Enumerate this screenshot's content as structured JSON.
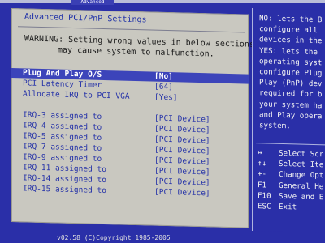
{
  "tab": {
    "label": "Advanced"
  },
  "main": {
    "title": "Advanced PCI/PnP Settings",
    "warning_line1": "WARNING: Setting wrong values in below sections",
    "warning_line2": "may cause system to malfunction.",
    "rows": [
      {
        "label": "Plug And Play O/S",
        "value": "[No]"
      },
      {
        "label": "PCI Latency Timer",
        "value": "[64]"
      },
      {
        "label": "Allocate IRQ to PCI VGA",
        "value": "[Yes]"
      },
      {
        "label": "IRQ-3 assigned to",
        "value": "[PCI Device]"
      },
      {
        "label": "IRQ-4 assigned to",
        "value": "[PCI Device]"
      },
      {
        "label": "IRQ-5 assigned to",
        "value": "[PCI Device]"
      },
      {
        "label": "IRQ-7 assigned to",
        "value": "[PCI Device]"
      },
      {
        "label": "IRQ-9 assigned to",
        "value": "[PCI Device]"
      },
      {
        "label": "IRQ-11 assigned to",
        "value": "[PCI Device]"
      },
      {
        "label": "IRQ-14 assigned to",
        "value": "[PCI Device]"
      },
      {
        "label": "IRQ-15 assigned to",
        "value": "[PCI Device]"
      }
    ]
  },
  "help": {
    "text": "NO: lets the B\nconfigure all\ndevices in the\nYES: lets the\noperating syst\nconfigure Plug\nPlay (PnP) dev\nrequired for b\nyour system ha\nand Play opera\nsystem."
  },
  "keys": [
    {
      "key": "↔",
      "desc": "Select Scr"
    },
    {
      "key": "↑↓",
      "desc": "Select Ite"
    },
    {
      "key": "+-",
      "desc": "Change Opt"
    },
    {
      "key": "F1",
      "desc": "General He"
    },
    {
      "key": "F10",
      "desc": "Save and E"
    },
    {
      "key": "ESC",
      "desc": "Exit"
    }
  ],
  "footer": {
    "text": "v02.58 (C)Copyright 1985-2005"
  }
}
